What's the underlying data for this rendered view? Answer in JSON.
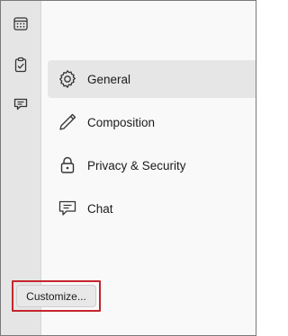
{
  "rail": {
    "items": [
      {
        "icon": "calendar-icon"
      },
      {
        "icon": "tasks-icon"
      },
      {
        "icon": "chat-icon"
      }
    ]
  },
  "nav": {
    "items": [
      {
        "label": "General",
        "icon": "gear-icon",
        "selected": true
      },
      {
        "label": "Composition",
        "icon": "pencil-icon",
        "selected": false
      },
      {
        "label": "Privacy & Security",
        "icon": "lock-icon",
        "selected": false
      },
      {
        "label": "Chat",
        "icon": "chat-icon",
        "selected": false
      }
    ]
  },
  "footer": {
    "customize_label": "Customize..."
  },
  "colors": {
    "selected_bg": "#e6e6e6",
    "rail_bg": "#e5e5e5",
    "highlight_border": "#c4262e"
  }
}
